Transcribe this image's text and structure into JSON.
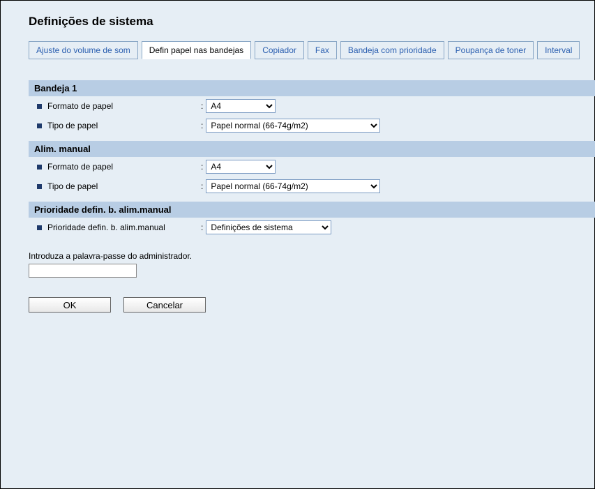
{
  "title": "Definições de sistema",
  "tabs": [
    {
      "label": "Ajuste do volume de som",
      "active": false
    },
    {
      "label": "Defin papel nas bandejas",
      "active": true
    },
    {
      "label": "Copiador",
      "active": false
    },
    {
      "label": "Fax",
      "active": false
    },
    {
      "label": "Bandeja com prioridade",
      "active": false
    },
    {
      "label": "Poupança de toner",
      "active": false
    },
    {
      "label": "Interval",
      "active": false
    }
  ],
  "sections": {
    "tray1": {
      "header": "Bandeja 1",
      "paperSize": {
        "label": "Formato de papel",
        "value": "A4"
      },
      "paperType": {
        "label": "Tipo de papel",
        "value": "Papel normal (66-74g/m2)"
      }
    },
    "manual": {
      "header": "Alim. manual",
      "paperSize": {
        "label": "Formato de papel",
        "value": "A4"
      },
      "paperType": {
        "label": "Tipo de papel",
        "value": "Papel normal (66-74g/m2)"
      }
    },
    "priority": {
      "header": "Prioridade defin. b. alim.manual",
      "setting": {
        "label": "Prioridade defin. b. alim.manual",
        "value": "Definições de sistema"
      }
    }
  },
  "admin": {
    "label": "Introduza a palavra-passe do administrador.",
    "value": ""
  },
  "buttons": {
    "ok": "OK",
    "cancel": "Cancelar"
  },
  "colon": ":"
}
